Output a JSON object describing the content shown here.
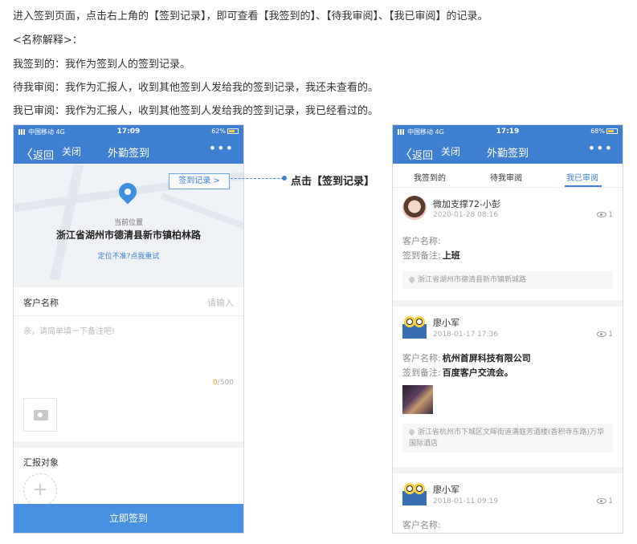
{
  "doc": {
    "line1": "进入签到页面，点击右上角的【签到记录】，即可查看【我签到的】、【待我审阅】、【我已审阅】的记录。",
    "line2": "<名称解释>：",
    "line3": "我签到的：我作为签到人的签到记录。",
    "line4": "待我审阅：我作为汇报人，收到其他签到人发给我的签到记录，我还未查看的。",
    "line5": "我已审阅：我作为汇报人，收到其他签到人发给我的签到记录，我已经看过的。"
  },
  "annotation": "点击【签到记录】",
  "left_phone": {
    "status": {
      "carrier": "中国移动 4G",
      "time": "17:09",
      "battery": "62%"
    },
    "nav": {
      "back": "返回",
      "close": "关闭",
      "title": "外勤签到",
      "more": "•••"
    },
    "record_button": "签到记录 >",
    "location_caption": "当前位置",
    "location_address": "浙江省湖州市德清县新市镇柏林路",
    "location_retry": "定位不准?点我重试",
    "customer_label": "客户名称",
    "customer_placeholder": "请输入",
    "remark_placeholder": "亲，请简单填一下备注吧!",
    "counter_current": "0",
    "counter_max": "/500",
    "report_label": "汇报对象",
    "add_symbol": "+",
    "submit": "立即签到"
  },
  "right_phone": {
    "status": {
      "carrier": "中国移动 4G",
      "time": "17:19",
      "battery": "68%"
    },
    "nav": {
      "back": "返回",
      "close": "关闭",
      "title": "外勤签到",
      "more": "•••"
    },
    "tabs": [
      "我签到的",
      "待我审阅",
      "我已审阅"
    ],
    "active_tab": 2,
    "cards": [
      {
        "name": "微加支撑72-小彭",
        "date": "2020-01-28 08:16",
        "views": "1",
        "customer_label": "客户名称:",
        "customer_value": "",
        "remark_label": "签到备注:",
        "remark_value": "上班",
        "address": "浙江省湖州市德清县新市镇新城路"
      },
      {
        "name": "廖小军",
        "date": "2018-01-17 17:36",
        "views": "1",
        "customer_label": "客户名称:",
        "customer_value": "杭州首屏科技有限公司",
        "remark_label": "签到备注:",
        "remark_value": "百度客户交流会。",
        "address": "浙江省杭州市下城区文晖街道满庭芳酒楼(香积寺东路)万华国际酒店"
      },
      {
        "name": "廖小军",
        "date": "2018-01-11 09:19",
        "views": "1",
        "customer_label": "客户名称:"
      }
    ]
  },
  "colors": {
    "brand": "#3e7fd1",
    "accent_orange": "#f39b2c"
  }
}
